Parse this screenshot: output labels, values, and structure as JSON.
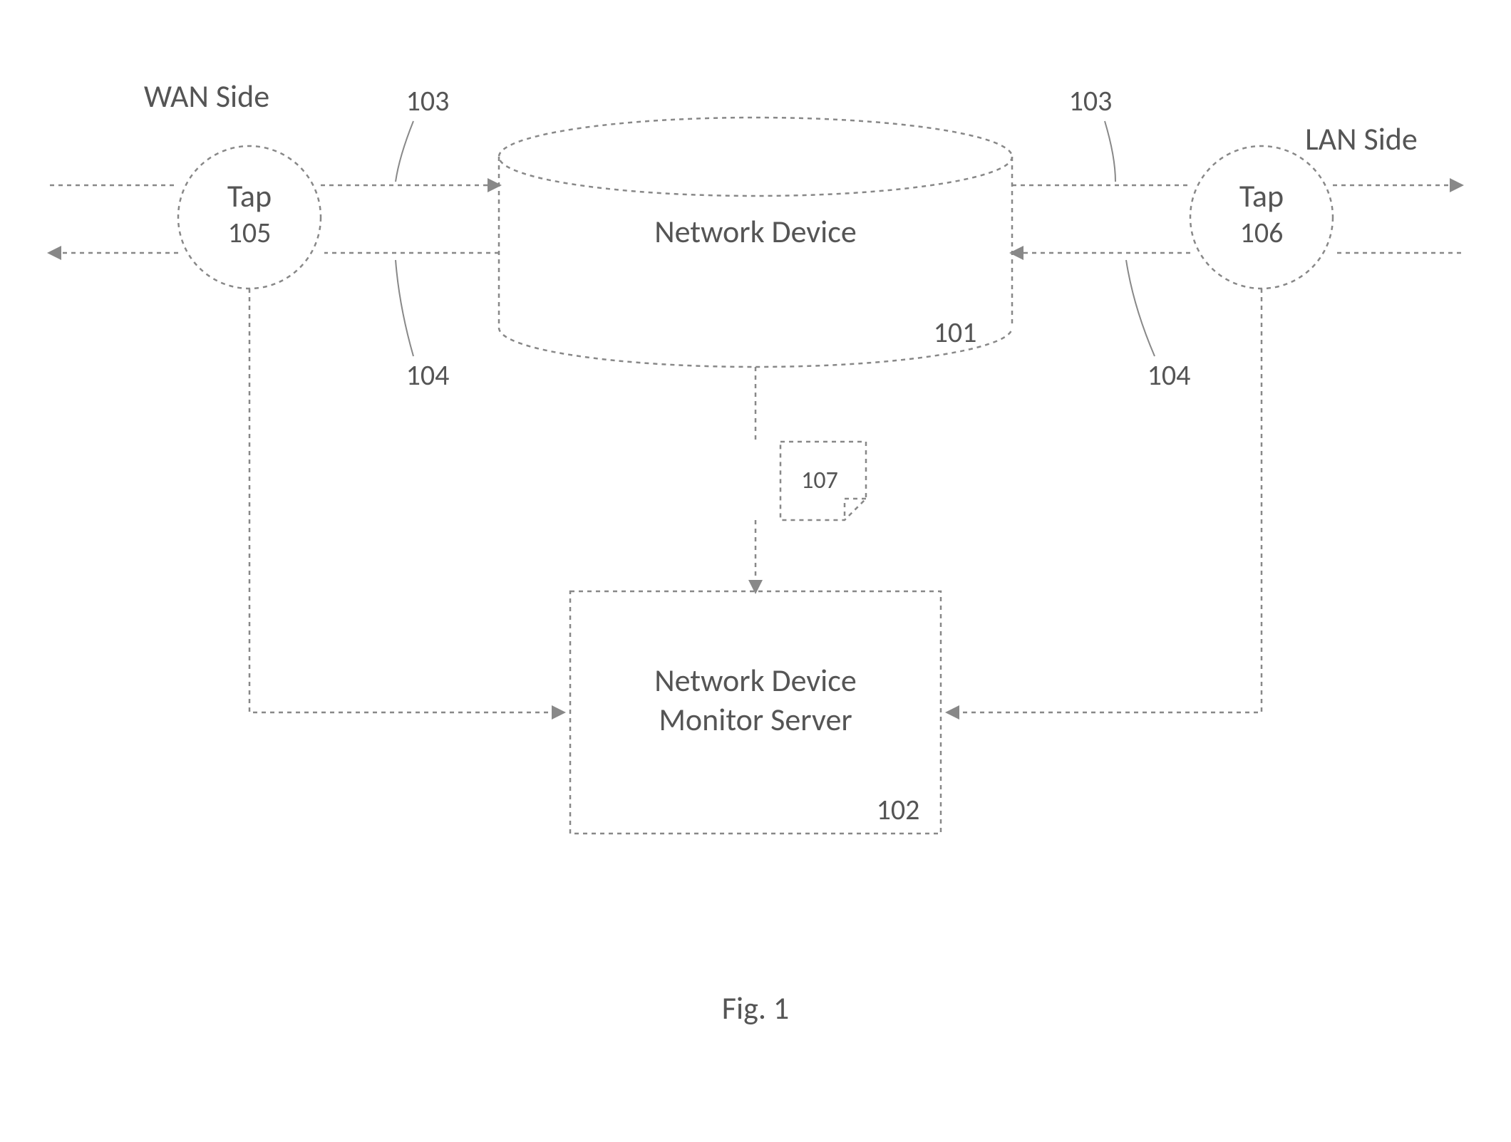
{
  "figure_caption": "Fig. 1",
  "wan_side_label": "WAN Side",
  "lan_side_label": "LAN Side",
  "network_device": {
    "title": "Network Device",
    "ref": "101"
  },
  "monitor_server": {
    "title_line1": "Network Device",
    "title_line2": "Monitor Server",
    "ref": "102"
  },
  "tap_left": {
    "title": "Tap",
    "ref": "105"
  },
  "tap_right": {
    "title": "Tap",
    "ref": "106"
  },
  "note": {
    "ref": "107"
  },
  "ref_top_left": "103",
  "ref_bottom_left": "104",
  "ref_top_right": "103",
  "ref_bottom_right": "104"
}
